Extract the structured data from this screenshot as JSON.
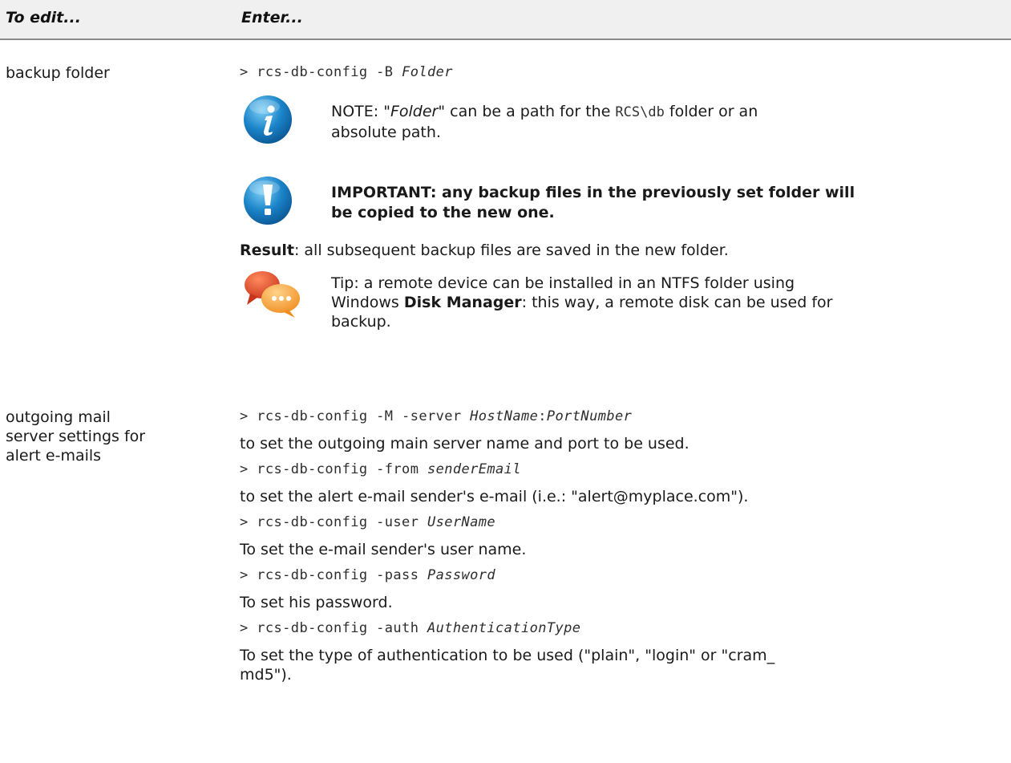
{
  "header": {
    "col1": "To edit...",
    "col2": "Enter..."
  },
  "backup": {
    "label": "backup folder",
    "command": {
      "prefix": "> rcs-db-config -B ",
      "arg": "Folder"
    },
    "note": {
      "icon": "info-icon",
      "prefix": "NOTE: \"",
      "folder_word": "Folder",
      "mid": "\" can be a path for the ",
      "path": "RCS\\db",
      "suffix_line1": " folder or an",
      "line2": "absolute path."
    },
    "important": {
      "icon": "exclamation-icon",
      "line1": "IMPORTANT: any backup files in the previously set folder will",
      "line2": "be copied to the new one."
    },
    "result": {
      "label": "Result",
      "text": ": all subsequent backup files are saved in the new folder."
    },
    "tip": {
      "icon": "chat-bubbles-icon",
      "line1": "Tip: a remote device can be installed in an NTFS folder using",
      "line2_prefix": "Windows ",
      "line2_bold": "Disk Manager",
      "line2_suffix": ": this way, a remote disk can be used for",
      "line3": "backup."
    }
  },
  "mail": {
    "label_lines": [
      "outgoing mail",
      "server settings for",
      "alert e-mails"
    ],
    "cmd_server": {
      "prefix": "> rcs-db-config -M -server ",
      "arg1": "HostName",
      "sep": ":",
      "arg2": "PortNumber"
    },
    "desc_server": "to set the outgoing main server name and port to be used.",
    "cmd_from": {
      "prefix": "> rcs-db-config -from ",
      "arg": "senderEmail"
    },
    "desc_from": "to set the alert e-mail sender's e-mail (i.e.: \"alert@myplace.com\").",
    "cmd_user": {
      "prefix": "> rcs-db-config -user ",
      "arg": "UserName"
    },
    "desc_user": "To set the e-mail sender's user name.",
    "cmd_pass": {
      "prefix": "> rcs-db-config -pass ",
      "arg": "Password"
    },
    "desc_pass": "To set his password.",
    "cmd_auth": {
      "prefix": "> rcs-db-config -auth ",
      "arg": "AuthenticationType"
    },
    "desc_auth_line1": "To set the type of authentication to be used (\"plain\", \"login\" or \"cram_",
    "desc_auth_line2": "md5\")."
  }
}
